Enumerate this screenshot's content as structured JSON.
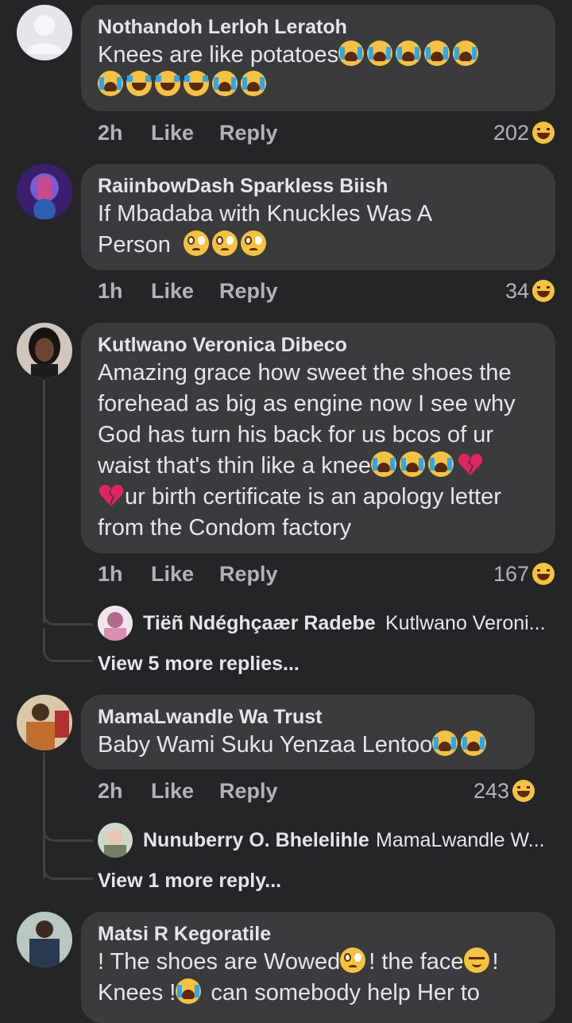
{
  "reaction_icon": "haha-reaction-icon",
  "comments": [
    {
      "author": "Nothandoh Lerloh Leratoh",
      "text": "Knees are like potatoes",
      "time": "2h",
      "like_label": "Like",
      "reply_label": "Reply",
      "reactions": "202"
    },
    {
      "author": "RaiinbowDash Sparkless Biish",
      "text_line1": "If Mbadaba with Knuckles Was A",
      "text_line2": "Person",
      "time": "1h",
      "like_label": "Like",
      "reply_label": "Reply",
      "reactions": "34"
    },
    {
      "author": "Kutlwano Veronica Dibeco",
      "text_1": "Amazing grace how sweet the shoes the forehead as big as engine now I see why God has turn his back for us bcos of ur waist that's thin like a knee",
      "text_2": "ur birth certificate is an apology letter from the Condom factory",
      "time": "1h",
      "like_label": "Like",
      "reply_label": "Reply",
      "reactions": "167",
      "reply_preview": {
        "name": "Tiëñ Ndéghçaær Radebe",
        "snippet": "Kutlwano Veroni..."
      },
      "more_replies": "View 5 more replies..."
    },
    {
      "author": "MamaLwandle Wa Trust",
      "text": "Baby Wami Suku Yenzaa Lentoo",
      "time": "2h",
      "like_label": "Like",
      "reply_label": "Reply",
      "reactions": "243",
      "reply_preview": {
        "name": "Nunuberry O. Bhelelihle",
        "snippet": "MamaLwandle W..."
      },
      "more_replies": "View 1 more reply..."
    },
    {
      "author": "Matsi R Kegoratile",
      "text_1": "! The shoes are Wowed",
      "text_2": "! the face",
      "text_3": "!",
      "text_4": "Knees !",
      "text_5": " can somebody help Her to"
    }
  ]
}
